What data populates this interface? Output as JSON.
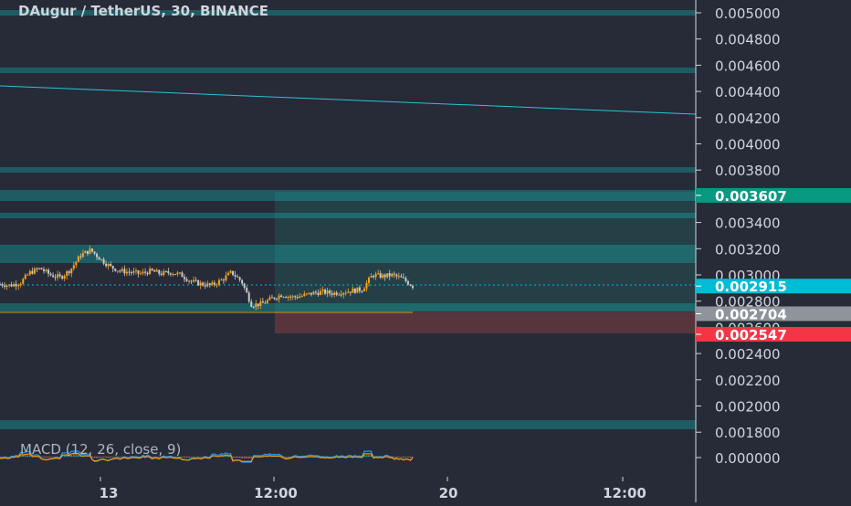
{
  "chart_title": "DAugur / TetherUS, 30, BINANCE",
  "price_axis": {
    "ticks": [
      "0.005000",
      "0.004800",
      "0.004600",
      "0.004400",
      "0.004200",
      "0.004000",
      "0.003800",
      "0.003400",
      "0.003200",
      "0.003000",
      "0.002800",
      "0.002600",
      "0.002400",
      "0.002200",
      "0.002000",
      "0.001800"
    ],
    "tick_values": [
      0.005,
      0.0048,
      0.0046,
      0.0044,
      0.0042,
      0.004,
      0.0038,
      0.0034,
      0.0032,
      0.003,
      0.0028,
      0.0026,
      0.0024,
      0.0022,
      0.002,
      0.0018
    ],
    "labels": [
      {
        "text": "0.003607",
        "value": 0.003607,
        "color": "#089981"
      },
      {
        "text": "0.002915",
        "value": 0.002915,
        "color": "#00bcd4"
      },
      {
        "text": "0.002704",
        "value": 0.002704,
        "color": "#8f939c"
      },
      {
        "text": "0.002547",
        "value": 0.002547,
        "color": "#f23645"
      }
    ]
  },
  "time_axis": {
    "labels": [
      "13",
      "12:00",
      "20",
      "12:00"
    ]
  },
  "indicator": {
    "label": "MACD (12, 26, close, 9)",
    "axis_label": "0.000000"
  },
  "chart_data": {
    "type": "line",
    "title": "DAugur / TetherUS, 30, BINANCE",
    "series": [
      {
        "name": "DAugur / TetherUS",
        "values": [
          0.00293,
          0.00292,
          0.00294,
          0.00302,
          0.00305,
          0.003,
          0.00298,
          0.00304,
          0.00315,
          0.00319,
          0.00312,
          0.00306,
          0.00303,
          0.00302,
          0.00301,
          0.00303,
          0.00301,
          0.00302,
          0.003,
          0.00295,
          0.00293,
          0.00292,
          0.00296,
          0.00302,
          0.00295,
          0.00277,
          0.00278,
          0.00282,
          0.00285,
          0.00283,
          0.00284,
          0.00286,
          0.00287,
          0.00286,
          0.00287,
          0.00288,
          0.00289,
          0.003,
          0.00299,
          0.003,
          0.00297,
          0.002915
        ]
      }
    ],
    "ylim": [
      0.00176,
      0.00505
    ]
  },
  "colors": {
    "background": "#262b37",
    "zone": "#1e5c64",
    "trendline": "#26c6da",
    "candle_up": "#f7a21b",
    "candle_down": "#c9c9c9",
    "text": "#d1d4dc"
  }
}
